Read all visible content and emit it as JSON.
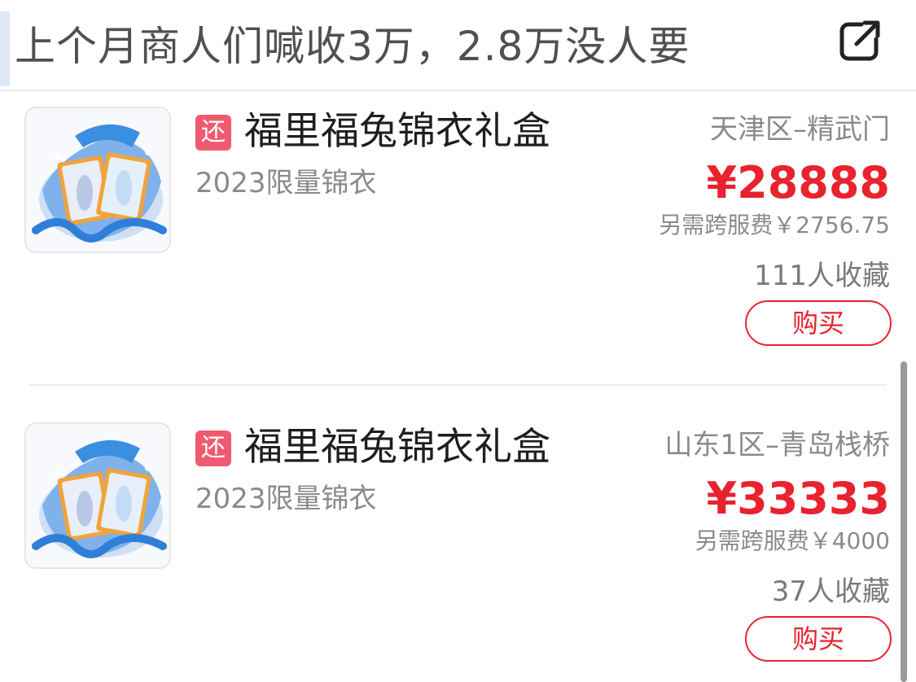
{
  "header": {
    "title": "上个月商人们喊收3万，2.8万没人要",
    "share_icon": "share-external-icon"
  },
  "listings": [
    {
      "badge": "还",
      "title": "福里福兔锦衣礼盒",
      "subtitle": "2023限量锦衣",
      "server": "天津区–精武门",
      "price": "¥28888",
      "fee": "另需跨服费￥2756.75",
      "favorites": "111人收藏",
      "buy_label": "购买",
      "image_icon": "rabbit-gift-box-icon"
    },
    {
      "badge": "还",
      "title": "福里福兔锦衣礼盒",
      "subtitle": "2023限量锦衣",
      "server": "山东1区–青岛栈桥",
      "price": "¥33333",
      "fee": "另需跨服费￥4000",
      "favorites": "37人收藏",
      "buy_label": "购买",
      "image_icon": "rabbit-gift-box-icon"
    }
  ],
  "colors": {
    "accent": "#e8232e",
    "badge": "#f05a70",
    "muted_text": "#8a8a8a",
    "box_blue": "#3b8fe0"
  }
}
